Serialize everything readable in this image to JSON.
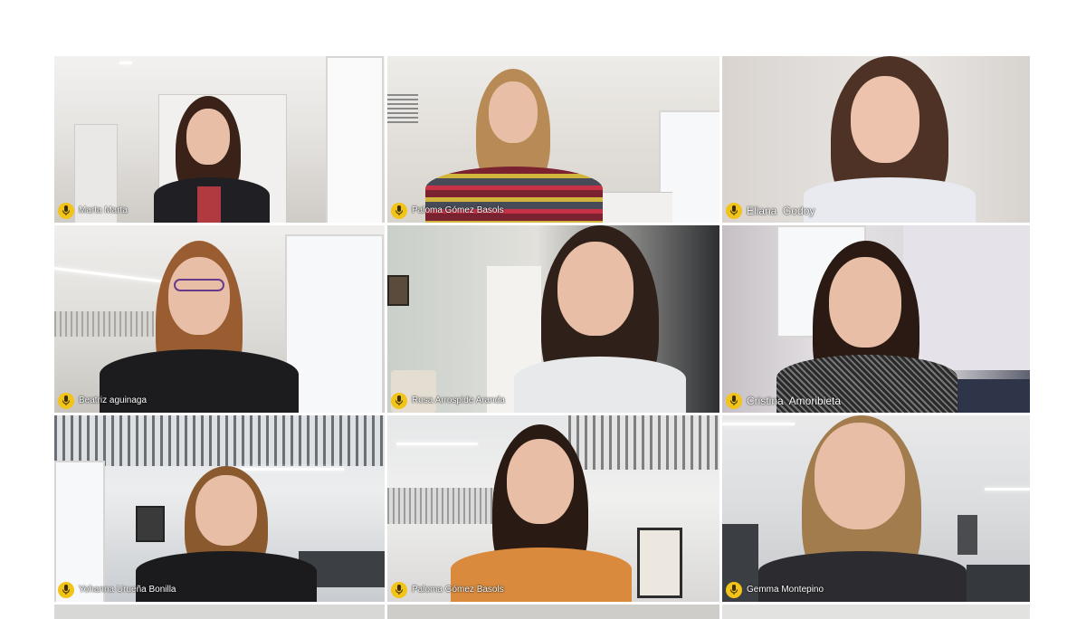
{
  "meeting": {
    "participants": [
      {
        "name": "Marta Marta"
      },
      {
        "name": "Paloma Gómez Basols"
      },
      {
        "name": "Eliana  Godoy"
      },
      {
        "name": "Beatriz aguinaga"
      },
      {
        "name": "Rosa Arrospide Aranda"
      },
      {
        "name": "Cristina  Amoribieta"
      },
      {
        "name": "Yohanna Urueña Bonilla"
      },
      {
        "name": "Paloma Gómez Basols"
      },
      {
        "name": "Gemma Montepino"
      }
    ]
  },
  "colors": {
    "mic_badge": "#f2c318",
    "name_text": "#ffffff"
  },
  "icons": {
    "mic": "microphone-icon"
  }
}
